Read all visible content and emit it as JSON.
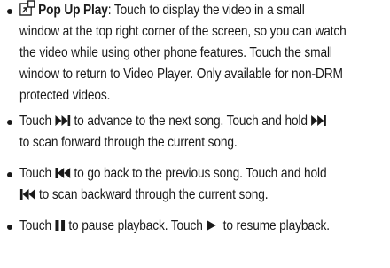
{
  "items": [
    {
      "id": "popup",
      "label": "Pop Up Play",
      "lines": [
        ": Touch to display the video in a small",
        "window at the top right corner of the screen, so you can watch",
        "the video while using other phone features. Touch the small",
        "window to return to Video Player. Only available for non-DRM",
        "protected videos."
      ],
      "icon": "pop-up-play-icon"
    },
    {
      "id": "next",
      "t1": "Touch",
      "t2": "to advance to the next song. Touch and hold",
      "t3": "to scan forward through the current song.",
      "icon": "fast-forward-icon"
    },
    {
      "id": "prev",
      "t1": "Touch",
      "t2": "to go back to the previous song. Touch and hold",
      "t3": "to scan backward through the current song.",
      "icon": "rewind-icon"
    },
    {
      "id": "pause",
      "t1": "Touch",
      "t2": "to pause playback. Touch",
      "t3": "to resume playback.",
      "icons": [
        "pause-icon",
        "play-icon"
      ]
    }
  ]
}
